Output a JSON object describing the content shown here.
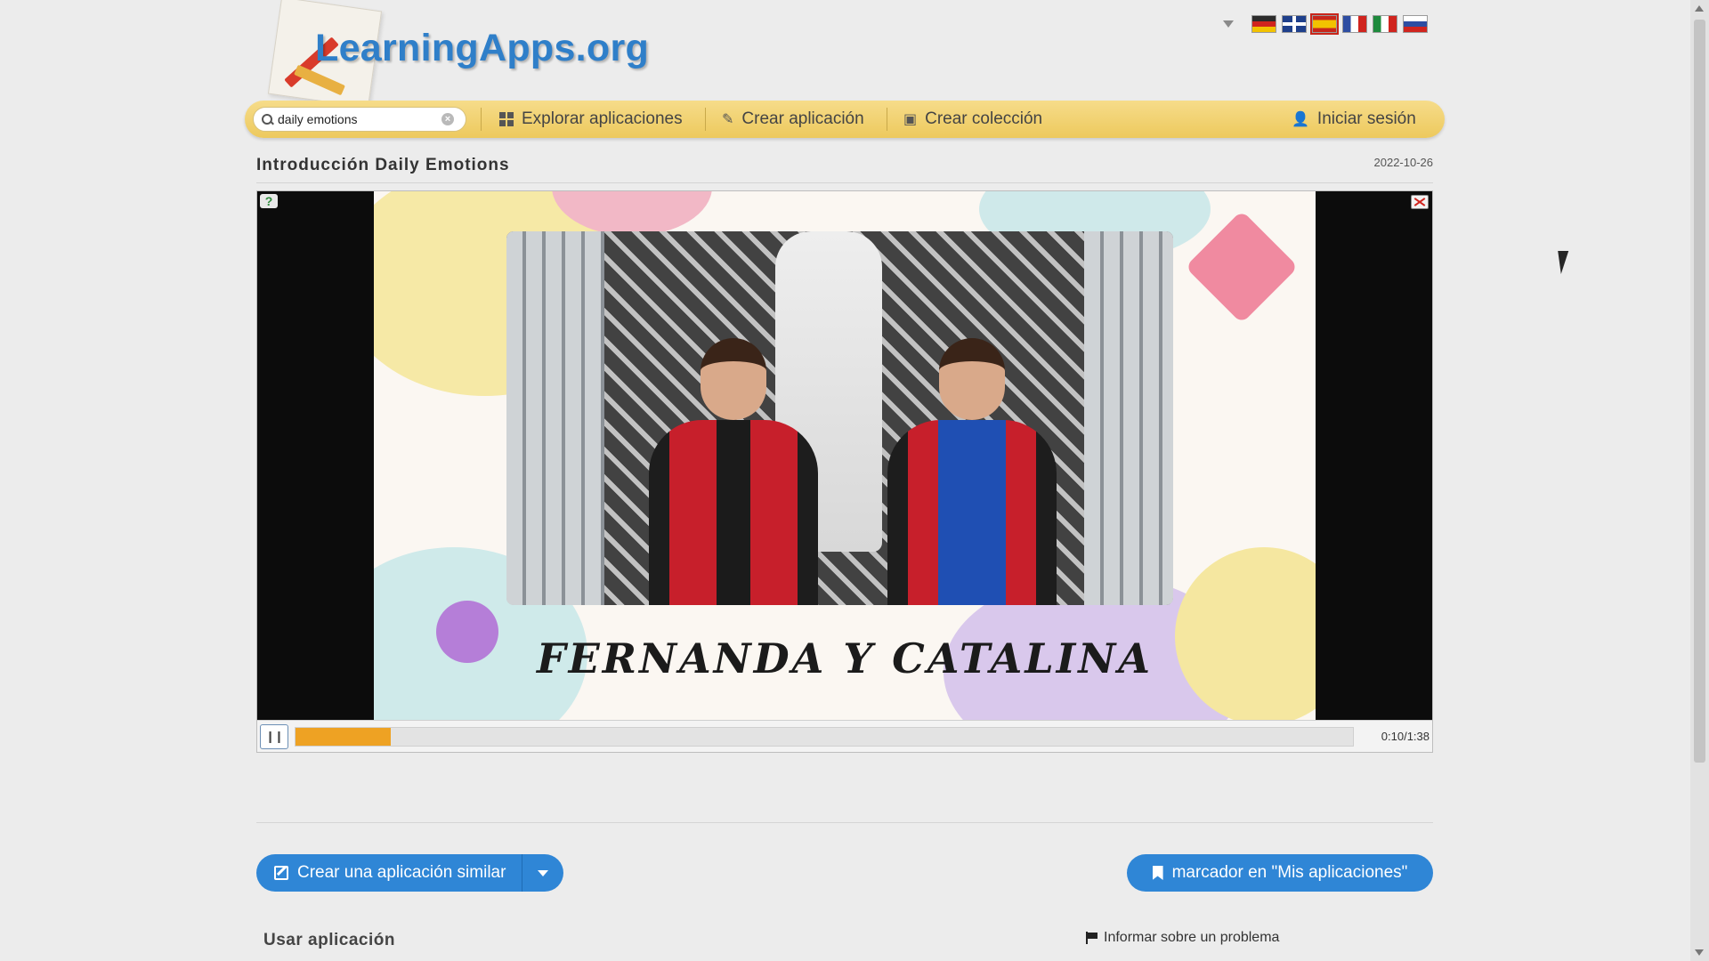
{
  "header": {
    "logo_text": "LearningApps.org",
    "languages": [
      "de",
      "en",
      "es",
      "fr",
      "it",
      "ru"
    ],
    "active_language": "es"
  },
  "navbar": {
    "search_value": "daily emotions",
    "explore_label": "Explorar aplicaciones",
    "create_app_label": "Crear aplicación",
    "create_collection_label": "Crear colección",
    "login_label": "Iniciar sesión"
  },
  "app": {
    "title": "Introducción Daily Emotions",
    "date": "2022-10-26",
    "video_caption": "FERNANDA Y CATALINA",
    "time_display": "0:10/1:38",
    "progress_fraction": 0.09
  },
  "actions": {
    "create_similar_label": "Crear una aplicación similar",
    "bookmark_label": "marcador en \"Mis aplicaciones\"",
    "use_app_label": "Usar aplicación",
    "report_label": "Informar sobre un problema"
  },
  "colors": {
    "accent": "#2f86d6",
    "navbar": "#f0cf6a",
    "progress": "#eea223"
  }
}
